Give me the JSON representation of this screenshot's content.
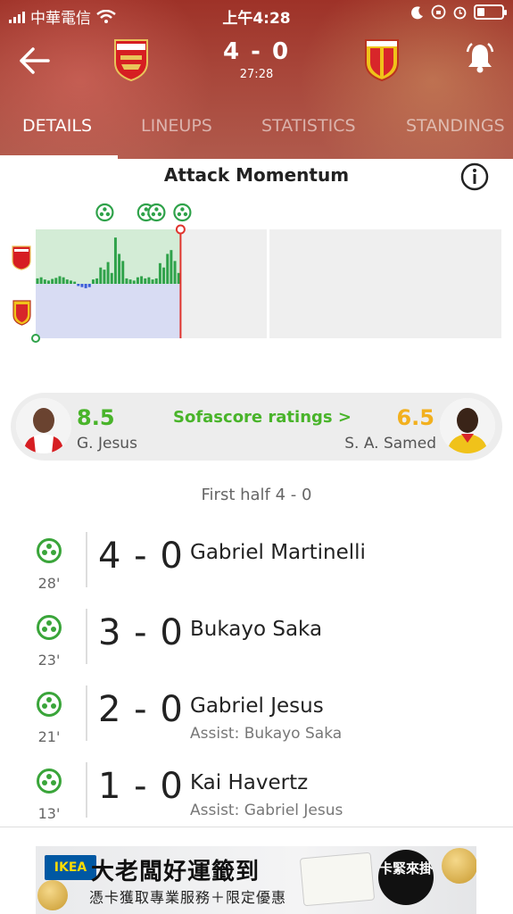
{
  "status_bar": {
    "carrier": "中華電信",
    "time": "上午4:28"
  },
  "header": {
    "home_team": "Arsenal",
    "away_team": "RC Lens",
    "score": "4 - 0",
    "clock": "27:28",
    "colors": {
      "accent": "#9e3228",
      "green": "#49b42a",
      "away_rating": "#f2b01e"
    }
  },
  "tabs": [
    {
      "label": "DETAILS",
      "active": true
    },
    {
      "label": "LINEUPS",
      "active": false
    },
    {
      "label": "STATISTICS",
      "active": false
    },
    {
      "label": "STANDINGS",
      "active": false
    }
  ],
  "momentum": {
    "title": "Attack Momentum",
    "goal_markers": 4
  },
  "chart_data": {
    "type": "bar",
    "title": "Attack Momentum",
    "x_unit": "minute",
    "xlim": [
      0,
      90
    ],
    "ylim": [
      -100,
      100
    ],
    "current_minute": 28,
    "goal_minutes": [
      13,
      21,
      23,
      28
    ],
    "values": [
      10,
      12,
      8,
      6,
      9,
      11,
      14,
      12,
      8,
      6,
      4,
      -4,
      -6,
      -8,
      -6,
      8,
      10,
      30,
      26,
      40,
      20,
      85,
      55,
      42,
      10,
      8,
      6,
      12,
      14,
      10,
      12,
      8,
      10,
      38,
      30,
      55,
      62,
      42,
      20
    ],
    "colors": {
      "home": "#2fa24a",
      "away": "#3c5fd6",
      "home_area": "#d3ecd6",
      "away_area": "#d8dcf3"
    }
  },
  "ratings": {
    "link_label": "Sofascore ratings >",
    "home_player": {
      "name": "G. Jesus",
      "rating": "8.5"
    },
    "away_player": {
      "name": "S. A. Samed",
      "rating": "6.5"
    }
  },
  "incidents": {
    "period_label": "First half 4 - 0",
    "items": [
      {
        "minute": "28'",
        "score": "4 - 0",
        "player": "Gabriel Martinelli",
        "assist": ""
      },
      {
        "minute": "23'",
        "score": "3 - 0",
        "player": "Bukayo Saka",
        "assist": ""
      },
      {
        "minute": "21'",
        "score": "2 - 0",
        "player": "Gabriel Jesus",
        "assist": "Assist: Bukayo Saka"
      },
      {
        "minute": "13'",
        "score": "1 - 0",
        "player": "Kai Havertz",
        "assist": "Assist: Gabriel Jesus"
      }
    ]
  },
  "ad": {
    "brand": "IKEA",
    "title": "大老闆好運籤到",
    "subtitle": "憑卡獲取專業服務＋限定優惠",
    "badge": "卡緊來掛"
  }
}
